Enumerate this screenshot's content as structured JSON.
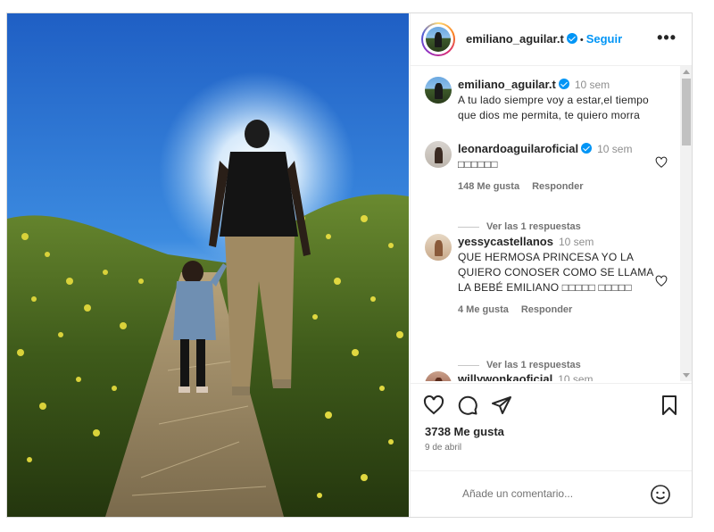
{
  "post": {
    "author": "emiliano_aguilar.t",
    "follow_label": "Seguir",
    "separator": "•",
    "more_label": "•••"
  },
  "caption": {
    "author": "emiliano_aguilar.t",
    "time": "10 sem",
    "text": "A tu lado siempre voy a estar,el tiempo que dios me permita, te quiero morra"
  },
  "comments": [
    {
      "author": "leonardoaguilaroficial",
      "verified": true,
      "time": "10 sem",
      "text": "□□□□□□",
      "likes": "148 Me gusta",
      "reply_label": "Responder",
      "view_replies": "Ver las 1 respuestas"
    },
    {
      "author": "yessycastellanos",
      "verified": false,
      "time": "10 sem",
      "text": "QUE HERMOSA PRINCESA YO LA QUIERO CONOSER COMO SE LLAMA LA BEBÉ EMILIANO □□□□□ □□□□□",
      "likes": "4 Me gusta",
      "reply_label": "Responder",
      "view_replies": "Ver las 1 respuestas"
    },
    {
      "author": "willywonkaoficial",
      "verified": false,
      "time": "10 sem"
    }
  ],
  "actions": {
    "likes": "3738 Me gusta",
    "date": "9 de abril",
    "icons": [
      "heart-icon",
      "comment-icon",
      "share-icon",
      "bookmark-icon"
    ]
  },
  "add_comment": {
    "placeholder": "Añade un comentario...",
    "emoji_icon": "smiley-icon"
  },
  "colors": {
    "link_blue": "#0095f6",
    "verified_blue": "#0095f6",
    "muted": "#737373"
  }
}
